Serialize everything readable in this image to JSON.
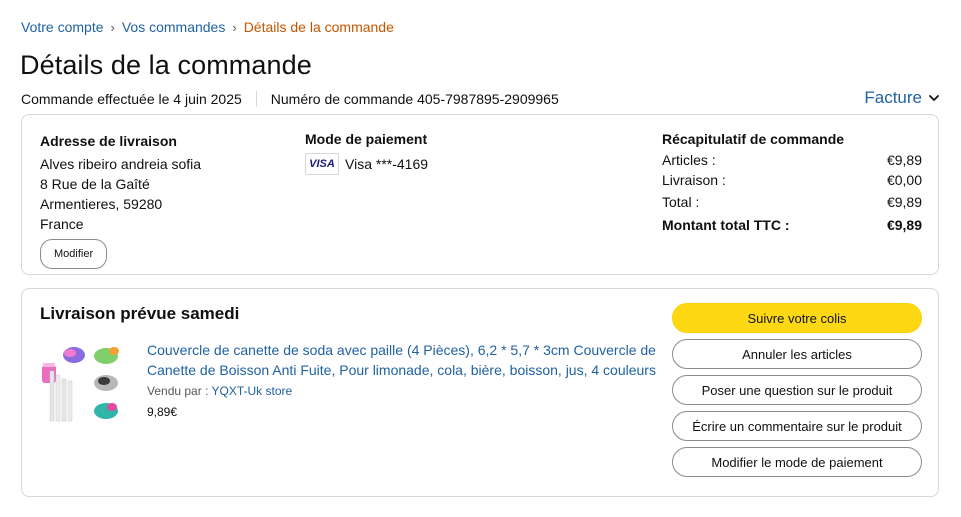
{
  "breadcrumb": {
    "items": [
      "Votre compte",
      "Vos commandes"
    ],
    "current": "Détails de la commande",
    "separator": "›"
  },
  "page": {
    "title": "Détails de la commande"
  },
  "order": {
    "placed": "Commande effectuée le 4 juin 2025",
    "number": "Numéro de commande 405-7987895-2909965"
  },
  "invoice": {
    "label": "Facture"
  },
  "shipping": {
    "title": "Adresse de livraison",
    "lines": [
      "Alves ribeiro andreia sofia",
      "8 Rue de la Gaîté",
      "Armentieres, 59280",
      "France"
    ],
    "edit_label": "Modifier"
  },
  "payment": {
    "title": "Mode de paiement",
    "card_brand": "VISA",
    "card_text": "Visa ***-4169"
  },
  "summary": {
    "title": "Récapitulatif de commande",
    "rows": [
      {
        "label": "Articles :",
        "value": "€9,89"
      },
      {
        "label": "Livraison :",
        "value": "€0,00"
      },
      {
        "label": "Total :",
        "value": "€9,89"
      },
      {
        "label": "Montant total TTC :",
        "value": "€9,89"
      }
    ]
  },
  "delivery": {
    "title": "Livraison prévue samedi",
    "product_title": "Couvercle de canette de soda avec paille (4 Pièces), 6,2 * 5,7 * 3cm Couvercle de Canette de Boisson Anti Fuite, Pour limonade, cola, bière, boisson, jus, 4 couleurs",
    "seller_label": "Vendu par",
    "seller_name": ": YQXT-Uk store",
    "price": "9,89€"
  },
  "actions": {
    "track": "Suivre votre colis",
    "cancel": "Annuler les articles",
    "question": "Poser une question sur le produit",
    "review": "Écrire un commentaire sur le produit",
    "change_payment": "Modifier le mode de paiement"
  },
  "colors": {
    "link": "#2162a1",
    "breadcrumb_current": "#C45500",
    "primary_button": "#FFD814",
    "border": "#D5D9D9"
  },
  "icons": {
    "invoice_chevron": "chevron-down-icon",
    "card": "visa-card-icon",
    "product": "product-thumbnail"
  }
}
